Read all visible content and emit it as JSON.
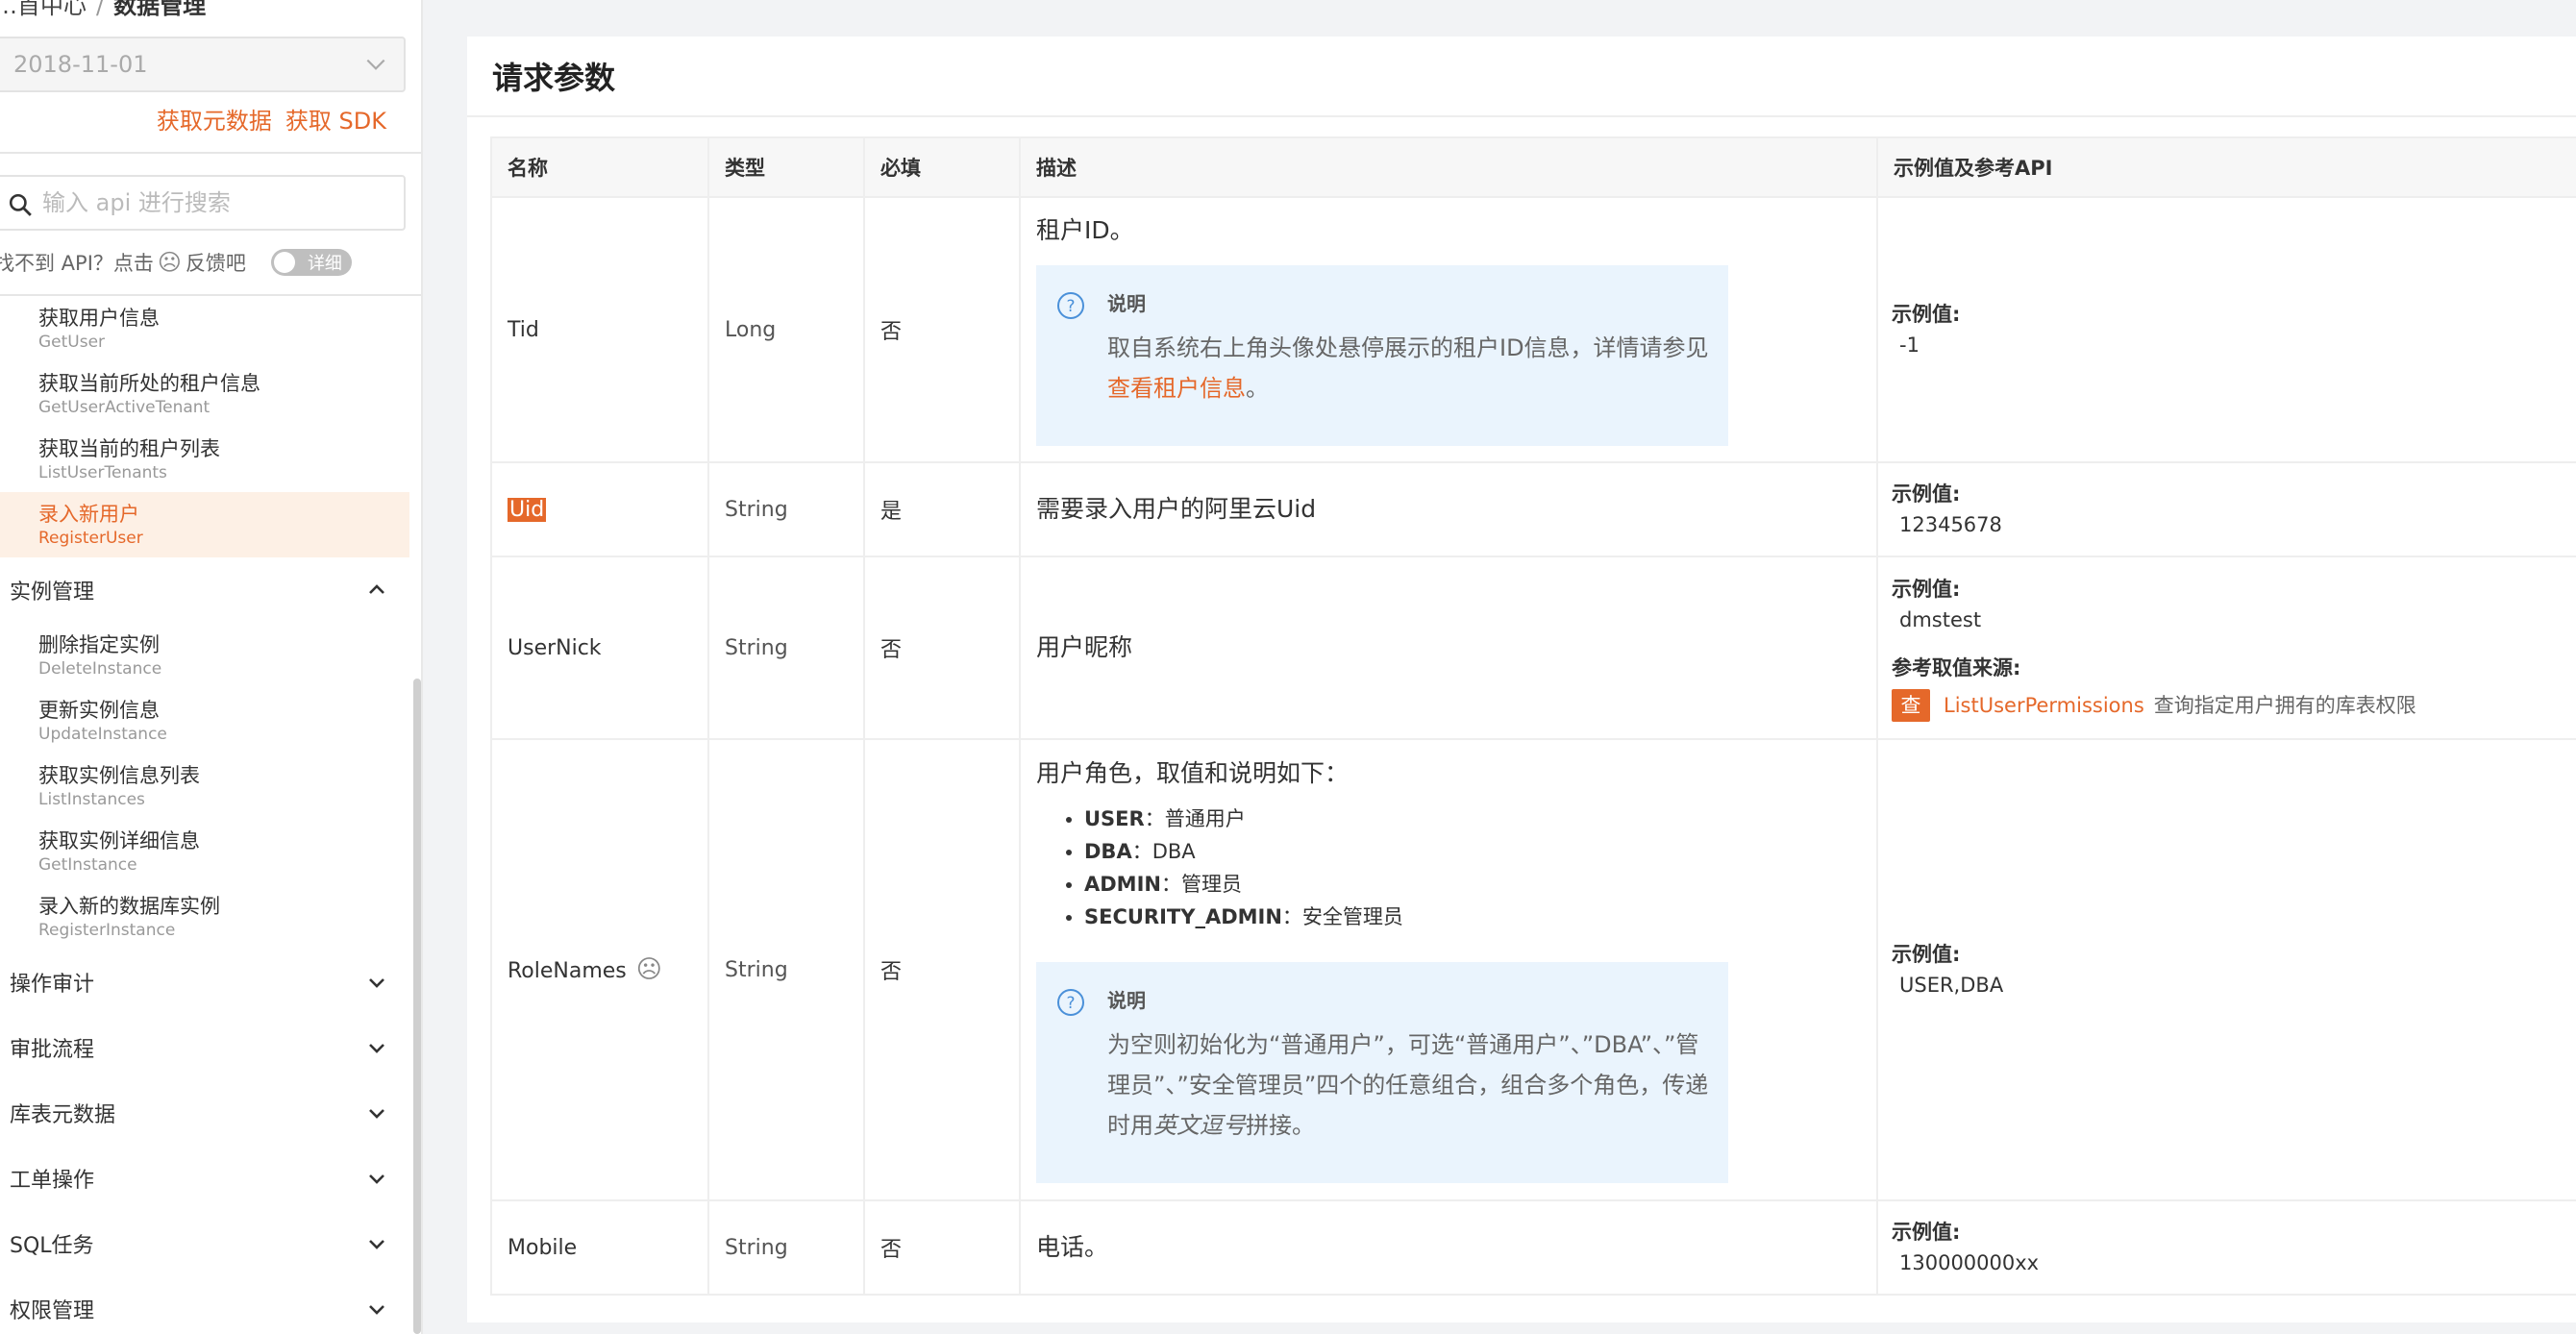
{
  "breadcrumb": {
    "parent": "…首中心",
    "current": "数据管理"
  },
  "version": {
    "value": "2018-11-01"
  },
  "links": {
    "metadata": "获取元数据",
    "sdk": "获取 SDK"
  },
  "search": {
    "placeholder": "输入 api 进行搜索"
  },
  "hint": {
    "prefix": "找不到 API？点击",
    "suffix": "反馈吧",
    "toggle": "详细"
  },
  "nav": {
    "items_top": [
      {
        "zh": "获取用户信息",
        "en": "GetUser"
      },
      {
        "zh": "获取当前所处的租户信息",
        "en": "GetUserActiveTenant"
      },
      {
        "zh": "获取当前的租户列表",
        "en": "ListUserTenants"
      },
      {
        "zh": "录入新用户",
        "en": "RegisterUser",
        "active": true
      }
    ],
    "group_instance": "实例管理",
    "items_instance": [
      {
        "zh": "删除指定实例",
        "en": "DeleteInstance"
      },
      {
        "zh": "更新实例信息",
        "en": "UpdateInstance"
      },
      {
        "zh": "获取实例信息列表",
        "en": "ListInstances"
      },
      {
        "zh": "获取实例详细信息",
        "en": "GetInstance"
      },
      {
        "zh": "录入新的数据库实例",
        "en": "RegisterInstance"
      }
    ],
    "groups_collapsed": [
      "操作审计",
      "审批流程",
      "库表元数据",
      "工单操作",
      "SQL任务",
      "权限管理"
    ]
  },
  "panel": {
    "title": "请求参数"
  },
  "table": {
    "headers": [
      "名称",
      "类型",
      "必填",
      "描述",
      "示例值及参考API"
    ],
    "example_label": "示例值:",
    "ref_label": "参考取值来源:",
    "note_title": "说明",
    "rows": {
      "tid": {
        "name": "Tid",
        "type": "Long",
        "required": "否",
        "desc": "租户ID。",
        "note_pre": "取自系统右上角头像处悬停展示的租户ID信息，详情请参见",
        "note_link": "查看租户信息",
        "note_post": "。",
        "example": "-1"
      },
      "uid": {
        "name": "Uid",
        "type": "String",
        "required": "是",
        "desc": "需要录入用户的阿里云Uid",
        "example": "12345678"
      },
      "usernick": {
        "name": "UserNick",
        "type": "String",
        "required": "否",
        "desc": "用户昵称",
        "example": "dmstest",
        "ref_badge": "查",
        "ref_link": "ListUserPermissions",
        "ref_desc": "查询指定用户拥有的库表权限"
      },
      "rolenames": {
        "name": "RoleNames",
        "type": "String",
        "required": "否",
        "desc": "用户角色，取值和说明如下：",
        "roles": [
          {
            "key": "USER",
            "val": "：普通用户"
          },
          {
            "key": "DBA",
            "val": "：DBA"
          },
          {
            "key": "ADMIN",
            "val": "：管理员"
          },
          {
            "key": "SECURITY_ADMIN",
            "val": "：安全管理员"
          }
        ],
        "note_pre": "为空则初始化为“普通用户”，可选“普通用户”、”DBA”、”管理员”、”安全管理员”四个的任意组合，组合多个角色，传递时用",
        "note_em": "英文逗号",
        "note_post": "拼接。",
        "example": "USER,DBA"
      },
      "mobile": {
        "name": "Mobile",
        "type": "String",
        "required": "否",
        "desc": "电话。",
        "example": "130000000xx"
      }
    }
  },
  "colors": {
    "accent": "#e5682a",
    "note_bg": "#eaf4fd",
    "active_bg": "#fdf0e5"
  }
}
